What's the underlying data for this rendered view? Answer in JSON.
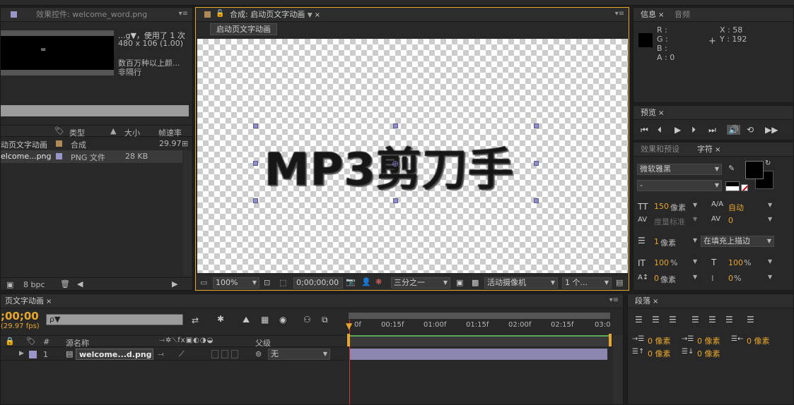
{
  "project_panel": {
    "tab_label": "效果控件: welcome_word.png",
    "thumb_caption": "=",
    "info_line1": "...g▼，使用了 1 次",
    "info_line2": "480 x 106 (1.00)",
    "info_line3": "数百万种以上颜...",
    "info_line4": "非隔行",
    "columns": {
      "type": "类型",
      "size": "大小",
      "fps": "帧速率"
    },
    "rows": [
      {
        "name": "动页文字动画",
        "type": "合成",
        "size": "",
        "fps": "29.97",
        "color": "#b08a56"
      },
      {
        "name": "elcome...png",
        "type": "PNG 文件",
        "size": "28 KB",
        "fps": "",
        "color": "#9a95c8"
      }
    ],
    "bpc_label": "8 bpc"
  },
  "comp_panel": {
    "tab_label": "合成: 启动页文字动画",
    "breadcrumb": "启动页文字动画",
    "canvas_text": "MP3剪刀手",
    "zoom": "100%",
    "timecode": "0;00;00;00",
    "grid": "三分之一",
    "camera": "活动摄像机",
    "views": "1 个...",
    "accent": "#e7a72d"
  },
  "info_panel": {
    "tab_info": "信息",
    "tab_audio": "音频",
    "r_label": "R :",
    "g_label": "G :",
    "b_label": "B :",
    "a_label": "A : 0",
    "x_label": "X : 58",
    "y_label": "Y : 192"
  },
  "preview_panel": {
    "tab": "预览"
  },
  "character_panel": {
    "tab_effects": "效果和预设",
    "tab_char": "字符",
    "font": "微软雅黑",
    "style": "-",
    "font_size": "150",
    "font_size_unit": "像素",
    "leading": "自动",
    "kerning": "度量标准",
    "tracking": "0",
    "stroke_width": "1",
    "stroke_unit": "像素",
    "stroke_mode": "在填充上描边",
    "vscale": "100",
    "hscale": "100",
    "pct": "%",
    "baseline": "0",
    "baseline_unit": "像素",
    "tsume": "0",
    "tsume_unit": "%"
  },
  "paragraph_panel": {
    "tab": "段落",
    "indent_left": "0 像素",
    "indent_first": "0 像素",
    "indent_right": "0 像素",
    "space_before": "0 像素",
    "space_after": "0 像素"
  },
  "timeline": {
    "tab_label": "页文字动画",
    "timecode": ";00;00",
    "fps": "(29.97 fps)",
    "search_placeholder": "ρ▼",
    "col_num": "#",
    "col_source": "源名称",
    "col_parent": "父级",
    "layer_num": "1",
    "layer_name": "welcome...d.png",
    "parent_value": "无",
    "ruler": [
      "0f",
      "00:15f",
      "01:00f",
      "01:15f",
      "02:00f",
      "02:15f",
      "03:0"
    ]
  }
}
